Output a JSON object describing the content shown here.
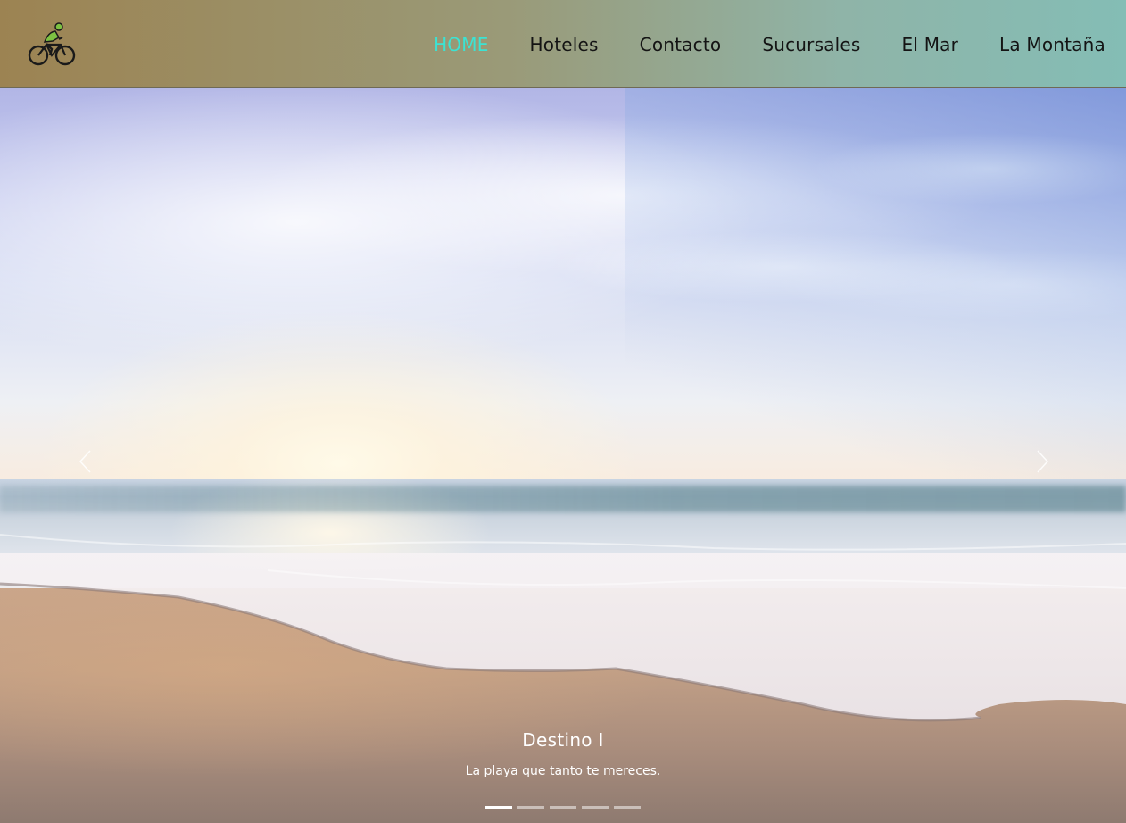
{
  "navbar": {
    "logo_icon": "cyclist-logo-icon",
    "links": [
      {
        "label": "HOME",
        "active": true
      },
      {
        "label": "Hoteles",
        "active": false
      },
      {
        "label": "Contacto",
        "active": false
      },
      {
        "label": "Sucursales",
        "active": false
      },
      {
        "label": "El Mar",
        "active": false
      },
      {
        "label": "La Montaña",
        "active": false
      }
    ],
    "active_color": "#3be3d3"
  },
  "carousel": {
    "prev_icon": "chevron-left-icon",
    "next_icon": "chevron-right-icon",
    "slide": {
      "image": "beach-sunrise-waves",
      "title": "Destino I",
      "text": "La playa que tanto te mereces."
    },
    "slide_count": 5,
    "active_index": 0
  }
}
